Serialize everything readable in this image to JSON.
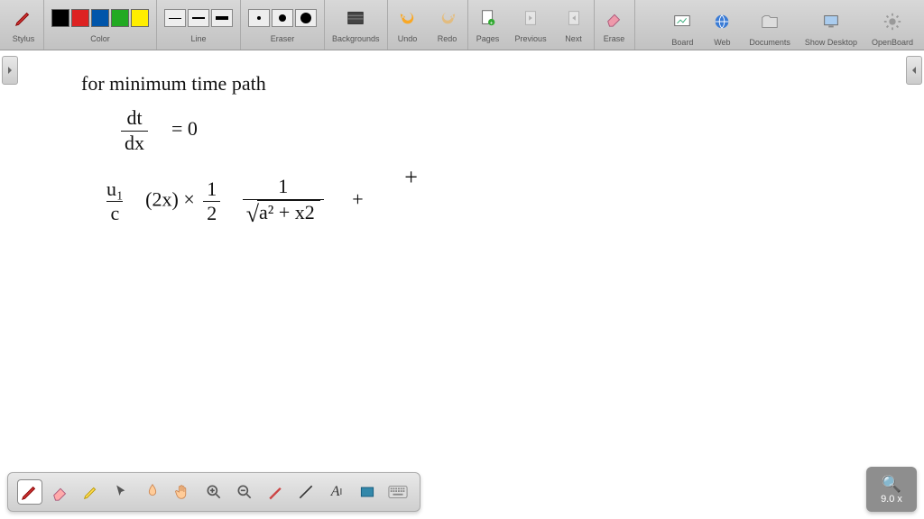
{
  "toolbar": {
    "stylus": "Stylus",
    "color": "Color",
    "line": "Line",
    "eraser": "Eraser",
    "backgrounds": "Backgrounds",
    "undo": "Undo",
    "redo": "Redo",
    "pages": "Pages",
    "previous": "Previous",
    "next": "Next",
    "erase": "Erase",
    "board": "Board",
    "web": "Web",
    "documents": "Documents",
    "showdesktop": "Show Desktop",
    "openboard": "OpenBoard"
  },
  "zoom": {
    "value": "9.0 x"
  },
  "handwriting": {
    "l1": "for minimum  time  path",
    "eq1_lhs_num": "dt",
    "eq1_lhs_den": "dx",
    "eq1_rhs": "= 0",
    "eq2_a_num": "u₁",
    "eq2_a_den": "c",
    "eq2_b": "(2x)  ×",
    "eq2_c_num": "1",
    "eq2_c_den": "2",
    "eq2_d_num": "1",
    "eq2_d_rad": "a² + x2",
    "eq2_plus1": "+",
    "eq2_plus2": "+"
  }
}
